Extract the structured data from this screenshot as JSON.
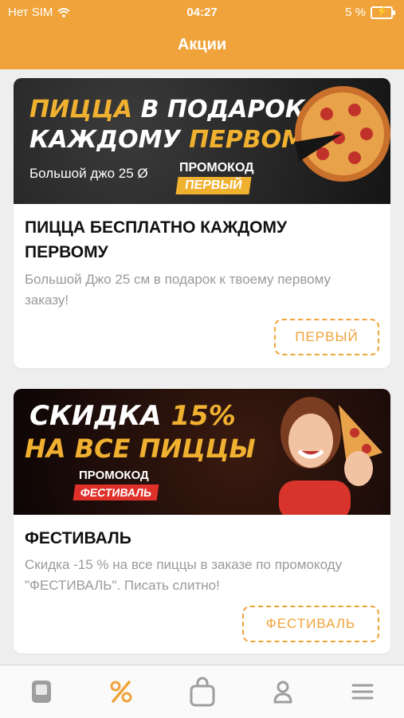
{
  "status_bar": {
    "carrier": "Нет SIM",
    "time": "04:27",
    "battery": "5 %"
  },
  "header": {
    "title": "Акции"
  },
  "promos": [
    {
      "banner": {
        "line1a": "ПИЦЦА",
        "line1b": "В ПОДАРОК",
        "line2a": "КАЖДОМУ",
        "line2b": "ПЕРВОМУ",
        "sub": "Большой джо 25 Ø",
        "promo_label": "ПРОМОКОД",
        "promo_code": "ПЕРВЫЙ"
      },
      "title": "ПИЦЦА БЕСПЛАТНО КАЖДОМУ ПЕРВОМУ",
      "description": "Большой Джо 25 см в подарок к твоему первому заказу!",
      "code_button": "ПЕРВЫЙ"
    },
    {
      "banner": {
        "line1a": "СКИДКА",
        "line1b": "15%",
        "line2": "НА ВСЕ ПИЦЦЫ",
        "promo_label": "ПРОМОКОД",
        "promo_code": "ФЕСТИВАЛЬ"
      },
      "title": "ФЕСТИВАЛЬ",
      "description": "Скидка -15 % на все пиццы в заказе по промокоду \"ФЕСТИВАЛЬ\". Писать слитно!",
      "code_button": "ФЕСТИВАЛЬ"
    }
  ],
  "tab_bar": {
    "items": [
      {
        "icon": "menu-book-icon",
        "active": false
      },
      {
        "icon": "percent-icon",
        "active": true
      },
      {
        "icon": "shopping-bag-icon",
        "active": false
      },
      {
        "icon": "profile-icon",
        "active": false
      },
      {
        "icon": "hamburger-menu-icon",
        "active": false
      }
    ]
  },
  "colors": {
    "accent": "#f0a33a",
    "inactive_icon": "#9e9e9e",
    "card_bg": "#ffffff",
    "page_bg": "#eeeeee"
  }
}
